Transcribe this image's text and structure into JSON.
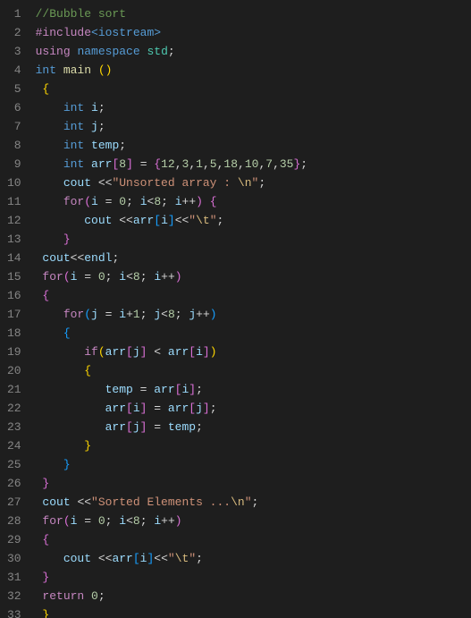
{
  "lines": [
    {
      "n": "1",
      "indent": 0,
      "tokens": [
        [
          "cmt",
          "//Bubble sort"
        ]
      ]
    },
    {
      "n": "2",
      "indent": 0,
      "tokens": [
        [
          "pp",
          "#include"
        ],
        [
          "pps",
          "<iostream>"
        ]
      ]
    },
    {
      "n": "3",
      "indent": 0,
      "tokens": [
        [
          "pp",
          "using"
        ],
        [
          "op",
          " "
        ],
        [
          "kw",
          "namespace"
        ],
        [
          "op",
          " "
        ],
        [
          "ns",
          "std"
        ],
        [
          "op",
          ";"
        ]
      ]
    },
    {
      "n": "4",
      "indent": 0,
      "tokens": [
        [
          "type",
          "int"
        ],
        [
          "op",
          " "
        ],
        [
          "fn",
          "main"
        ],
        [
          "op",
          " "
        ],
        [
          "br1",
          "("
        ],
        [
          "br1",
          ")"
        ]
      ]
    },
    {
      "n": "5",
      "indent": 0,
      "tokens": [
        [
          "br1",
          "{"
        ]
      ]
    },
    {
      "n": "6",
      "indent": 1,
      "tokens": [
        [
          "type",
          "int"
        ],
        [
          "op",
          " "
        ],
        [
          "id",
          "i"
        ],
        [
          "op",
          ";"
        ]
      ]
    },
    {
      "n": "7",
      "indent": 1,
      "tokens": [
        [
          "type",
          "int"
        ],
        [
          "op",
          " "
        ],
        [
          "id",
          "j"
        ],
        [
          "op",
          ";"
        ]
      ]
    },
    {
      "n": "8",
      "indent": 1,
      "tokens": [
        [
          "type",
          "int"
        ],
        [
          "op",
          " "
        ],
        [
          "id",
          "temp"
        ],
        [
          "op",
          ";"
        ]
      ]
    },
    {
      "n": "9",
      "indent": 1,
      "tokens": [
        [
          "type",
          "int"
        ],
        [
          "op",
          " "
        ],
        [
          "id",
          "arr"
        ],
        [
          "br2",
          "["
        ],
        [
          "num",
          "8"
        ],
        [
          "br2",
          "]"
        ],
        [
          "op",
          " = "
        ],
        [
          "br2",
          "{"
        ],
        [
          "num",
          "12"
        ],
        [
          "op",
          ","
        ],
        [
          "num",
          "3"
        ],
        [
          "op",
          ","
        ],
        [
          "num",
          "1"
        ],
        [
          "op",
          ","
        ],
        [
          "num",
          "5"
        ],
        [
          "op",
          ","
        ],
        [
          "num",
          "18"
        ],
        [
          "op",
          ","
        ],
        [
          "num",
          "10"
        ],
        [
          "op",
          ","
        ],
        [
          "num",
          "7"
        ],
        [
          "op",
          ","
        ],
        [
          "num",
          "35"
        ],
        [
          "br2",
          "}"
        ],
        [
          "op",
          ";"
        ]
      ]
    },
    {
      "n": "10",
      "indent": 1,
      "tokens": [
        [
          "cout",
          "cout"
        ],
        [
          "op",
          " <<"
        ],
        [
          "str",
          "\"Unsorted array : "
        ],
        [
          "esc",
          "\\n"
        ],
        [
          "str",
          "\""
        ],
        [
          "op",
          ";"
        ]
      ]
    },
    {
      "n": "11",
      "indent": 1,
      "tokens": [
        [
          "kw2",
          "for"
        ],
        [
          "br2",
          "("
        ],
        [
          "id",
          "i"
        ],
        [
          "op",
          " = "
        ],
        [
          "num",
          "0"
        ],
        [
          "op",
          "; "
        ],
        [
          "id",
          "i"
        ],
        [
          "op",
          "<"
        ],
        [
          "num",
          "8"
        ],
        [
          "op",
          "; "
        ],
        [
          "id",
          "i"
        ],
        [
          "op",
          "++"
        ],
        [
          "br2",
          ")"
        ],
        [
          "op",
          " "
        ],
        [
          "br2",
          "{"
        ]
      ]
    },
    {
      "n": "12",
      "indent": 2,
      "tokens": [
        [
          "cout",
          "cout"
        ],
        [
          "op",
          " <<"
        ],
        [
          "id",
          "arr"
        ],
        [
          "br3",
          "["
        ],
        [
          "id",
          "i"
        ],
        [
          "br3",
          "]"
        ],
        [
          "op",
          "<<"
        ],
        [
          "str",
          "\""
        ],
        [
          "esc",
          "\\t"
        ],
        [
          "str",
          "\""
        ],
        [
          "op",
          ";"
        ]
      ]
    },
    {
      "n": "13",
      "indent": 1,
      "tokens": [
        [
          "br2",
          "}"
        ]
      ]
    },
    {
      "n": "14",
      "indent": 0,
      "tokens": [
        [
          "cout",
          "cout"
        ],
        [
          "op",
          "<<"
        ],
        [
          "endl",
          "endl"
        ],
        [
          "op",
          ";"
        ]
      ]
    },
    {
      "n": "15",
      "indent": 0,
      "tokens": [
        [
          "kw2",
          "for"
        ],
        [
          "br2",
          "("
        ],
        [
          "id",
          "i"
        ],
        [
          "op",
          " = "
        ],
        [
          "num",
          "0"
        ],
        [
          "op",
          "; "
        ],
        [
          "id",
          "i"
        ],
        [
          "op",
          "<"
        ],
        [
          "num",
          "8"
        ],
        [
          "op",
          "; "
        ],
        [
          "id",
          "i"
        ],
        [
          "op",
          "++"
        ],
        [
          "br2",
          ")"
        ]
      ]
    },
    {
      "n": "16",
      "indent": 0,
      "tokens": [
        [
          "br2",
          "{"
        ]
      ]
    },
    {
      "n": "17",
      "indent": 1,
      "tokens": [
        [
          "kw2",
          "for"
        ],
        [
          "br3",
          "("
        ],
        [
          "id",
          "j"
        ],
        [
          "op",
          " = "
        ],
        [
          "id",
          "i"
        ],
        [
          "op",
          "+"
        ],
        [
          "num",
          "1"
        ],
        [
          "op",
          "; "
        ],
        [
          "id",
          "j"
        ],
        [
          "op",
          "<"
        ],
        [
          "num",
          "8"
        ],
        [
          "op",
          "; "
        ],
        [
          "id",
          "j"
        ],
        [
          "op",
          "++"
        ],
        [
          "br3",
          ")"
        ]
      ]
    },
    {
      "n": "18",
      "indent": 1,
      "tokens": [
        [
          "br3",
          "{"
        ]
      ]
    },
    {
      "n": "19",
      "indent": 2,
      "tokens": [
        [
          "kw2",
          "if"
        ],
        [
          "br1",
          "("
        ],
        [
          "id",
          "arr"
        ],
        [
          "br2",
          "["
        ],
        [
          "id",
          "j"
        ],
        [
          "br2",
          "]"
        ],
        [
          "op",
          " < "
        ],
        [
          "id",
          "arr"
        ],
        [
          "br2",
          "["
        ],
        [
          "id",
          "i"
        ],
        [
          "br2",
          "]"
        ],
        [
          "br1",
          ")"
        ]
      ]
    },
    {
      "n": "20",
      "indent": 2,
      "tokens": [
        [
          "br1",
          "{"
        ]
      ]
    },
    {
      "n": "21",
      "indent": 3,
      "tokens": [
        [
          "id",
          "temp"
        ],
        [
          "op",
          " = "
        ],
        [
          "id",
          "arr"
        ],
        [
          "br2",
          "["
        ],
        [
          "id",
          "i"
        ],
        [
          "br2",
          "]"
        ],
        [
          "op",
          ";"
        ]
      ]
    },
    {
      "n": "22",
      "indent": 3,
      "tokens": [
        [
          "id",
          "arr"
        ],
        [
          "br2",
          "["
        ],
        [
          "id",
          "i"
        ],
        [
          "br2",
          "]"
        ],
        [
          "op",
          " = "
        ],
        [
          "id",
          "arr"
        ],
        [
          "br2",
          "["
        ],
        [
          "id",
          "j"
        ],
        [
          "br2",
          "]"
        ],
        [
          "op",
          ";"
        ]
      ]
    },
    {
      "n": "23",
      "indent": 3,
      "tokens": [
        [
          "id",
          "arr"
        ],
        [
          "br2",
          "["
        ],
        [
          "id",
          "j"
        ],
        [
          "br2",
          "]"
        ],
        [
          "op",
          " = "
        ],
        [
          "id",
          "temp"
        ],
        [
          "op",
          ";"
        ]
      ]
    },
    {
      "n": "24",
      "indent": 2,
      "tokens": [
        [
          "br1",
          "}"
        ]
      ]
    },
    {
      "n": "25",
      "indent": 1,
      "tokens": [
        [
          "br3",
          "}"
        ]
      ]
    },
    {
      "n": "26",
      "indent": 0,
      "tokens": [
        [
          "br2",
          "}"
        ]
      ]
    },
    {
      "n": "27",
      "indent": 0,
      "tokens": [
        [
          "cout",
          "cout"
        ],
        [
          "op",
          " <<"
        ],
        [
          "str",
          "\"Sorted Elements ..."
        ],
        [
          "esc",
          "\\n"
        ],
        [
          "str",
          "\""
        ],
        [
          "op",
          ";"
        ]
      ]
    },
    {
      "n": "28",
      "indent": 0,
      "tokens": [
        [
          "kw2",
          "for"
        ],
        [
          "br2",
          "("
        ],
        [
          "id",
          "i"
        ],
        [
          "op",
          " = "
        ],
        [
          "num",
          "0"
        ],
        [
          "op",
          "; "
        ],
        [
          "id",
          "i"
        ],
        [
          "op",
          "<"
        ],
        [
          "num",
          "8"
        ],
        [
          "op",
          "; "
        ],
        [
          "id",
          "i"
        ],
        [
          "op",
          "++"
        ],
        [
          "br2",
          ")"
        ]
      ]
    },
    {
      "n": "29",
      "indent": 0,
      "tokens": [
        [
          "br2",
          "{"
        ]
      ]
    },
    {
      "n": "30",
      "indent": 1,
      "tokens": [
        [
          "cout",
          "cout"
        ],
        [
          "op",
          " <<"
        ],
        [
          "id",
          "arr"
        ],
        [
          "br3",
          "["
        ],
        [
          "id",
          "i"
        ],
        [
          "br3",
          "]"
        ],
        [
          "op",
          "<<"
        ],
        [
          "str",
          "\""
        ],
        [
          "esc",
          "\\t"
        ],
        [
          "str",
          "\""
        ],
        [
          "op",
          ";"
        ]
      ]
    },
    {
      "n": "31",
      "indent": 0,
      "tokens": [
        [
          "br2",
          "}"
        ]
      ]
    },
    {
      "n": "32",
      "indent": 0,
      "tokens": [
        [
          "kw2",
          "return"
        ],
        [
          "op",
          " "
        ],
        [
          "num",
          "0"
        ],
        [
          "op",
          ";"
        ]
      ]
    },
    {
      "n": "33",
      "indent": 0,
      "tokens": [
        [
          "br1",
          "}"
        ]
      ]
    }
  ],
  "indent_unit": "   ",
  "base_indent": " "
}
